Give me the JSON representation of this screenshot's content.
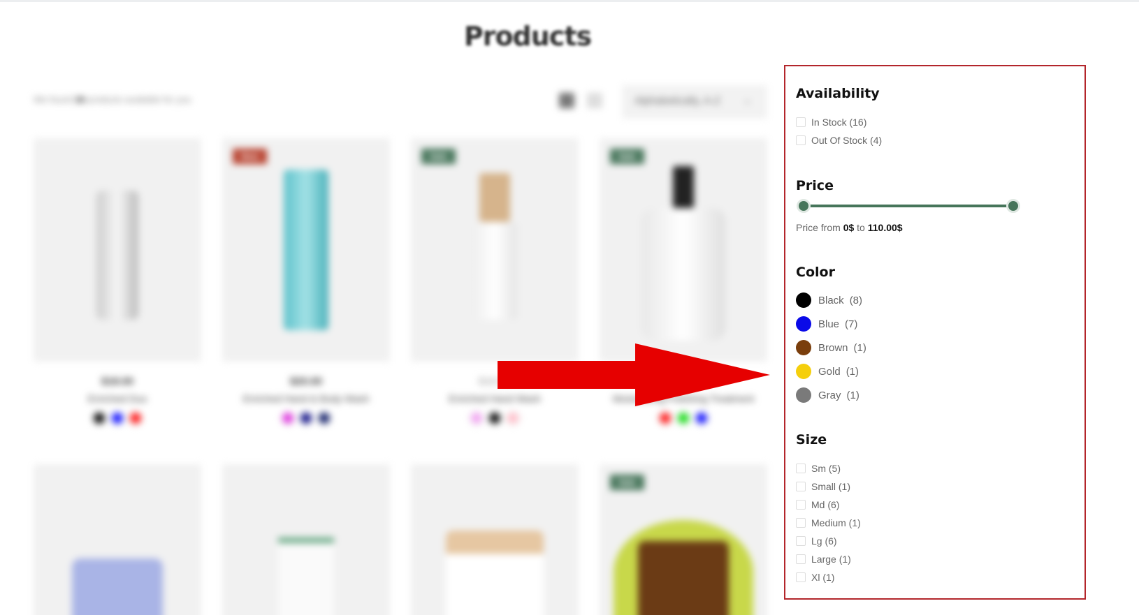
{
  "page": {
    "title": "Products"
  },
  "toolbar": {
    "found_prefix": "We found",
    "found_count": "16",
    "found_suffix": "products available for you",
    "sort_value": "Alphabetically, A-Z"
  },
  "products": [
    {
      "badge": "",
      "price": "$18.00",
      "old_price": "",
      "name": "Enriched Duo",
      "swatches": [
        "#111111",
        "#1a1aff",
        "#ff2020"
      ]
    },
    {
      "badge": "New",
      "price": "$20.00",
      "old_price": "",
      "name": "Enriched Hand & Body Wash",
      "swatches": [
        "#e040e0",
        "#1a1a8c",
        "#1c2870"
      ]
    },
    {
      "badge": "Sale",
      "price": "",
      "old_price": "$16.00",
      "name": "Enriched Hand Wash",
      "swatches": [
        "#f2a6f2",
        "#111111",
        "#ffc0cb"
      ]
    },
    {
      "badge": "Sale",
      "price": "",
      "old_price": "",
      "name": "Moisturizing Polishing Treatment",
      "swatches": [
        "#ff2020",
        "#20dd20",
        "#1a1aff"
      ]
    },
    {
      "badge": "",
      "name": ""
    },
    {
      "badge": "",
      "name": ""
    },
    {
      "badge": "",
      "name": ""
    },
    {
      "badge": "Sale",
      "name": ""
    }
  ],
  "filters": {
    "availability": {
      "title": "Availability",
      "options": [
        {
          "label": "In Stock (16)"
        },
        {
          "label": "Out Of Stock (4)"
        }
      ]
    },
    "price": {
      "title": "Price",
      "from_label": "Price from",
      "min": "0$",
      "to_label": "to",
      "max": "110.00$"
    },
    "color": {
      "title": "Color",
      "options": [
        {
          "label": "Black",
          "count": "(8)",
          "hex": "#000000"
        },
        {
          "label": "Blue",
          "count": "(7)",
          "hex": "#0a0ae8"
        },
        {
          "label": "Brown",
          "count": "(1)",
          "hex": "#7a3e0c"
        },
        {
          "label": "Gold",
          "count": "(1)",
          "hex": "#f5cf0c"
        },
        {
          "label": "Gray",
          "count": "(1)",
          "hex": "#7a7a7a"
        }
      ]
    },
    "size": {
      "title": "Size",
      "options": [
        {
          "label": "Sm (5)"
        },
        {
          "label": "Small (1)"
        },
        {
          "label": "Md (6)"
        },
        {
          "label": "Medium (1)"
        },
        {
          "label": "Lg (6)"
        },
        {
          "label": "Large (1)"
        },
        {
          "label": "Xl (1)"
        }
      ]
    }
  },
  "colors": {
    "accent": "#46755a",
    "highlight_border": "#b3262b",
    "arrow": "#e60000"
  }
}
